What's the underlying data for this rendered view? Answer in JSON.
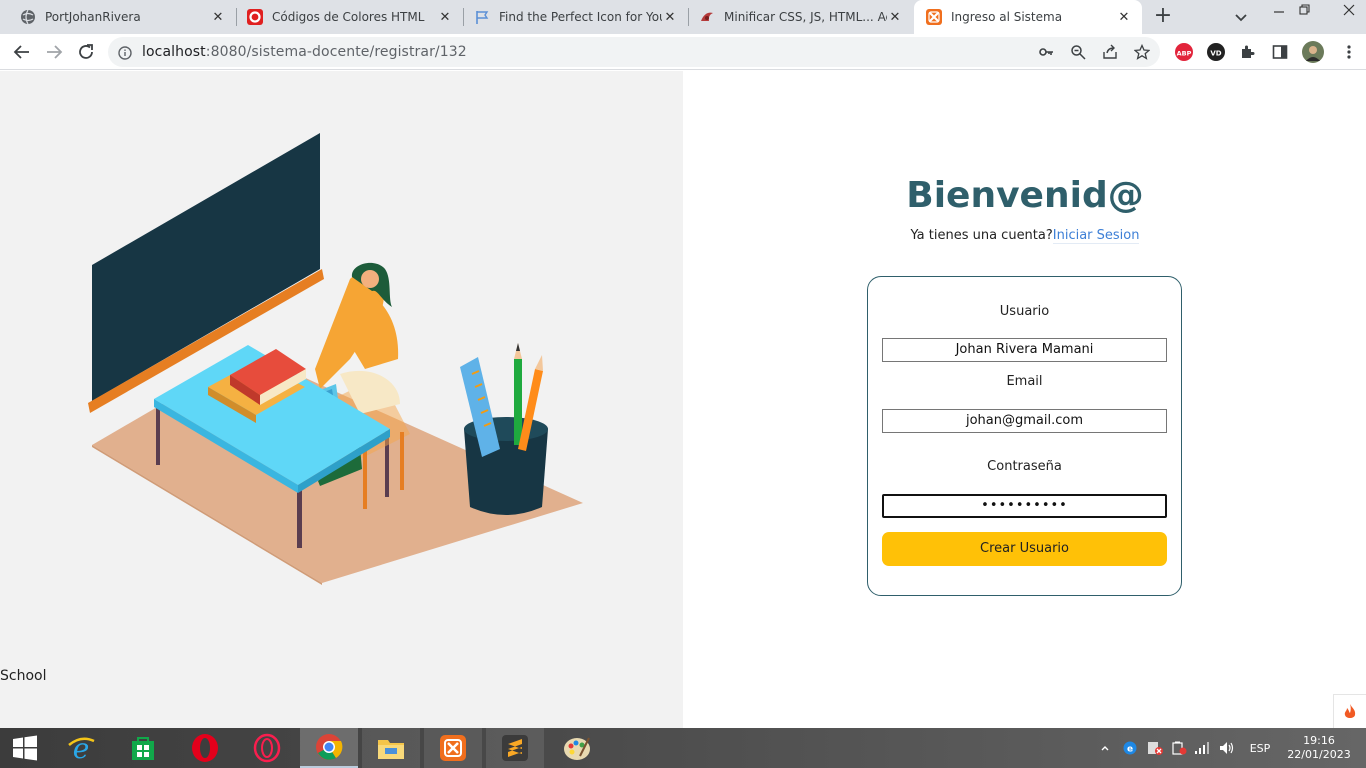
{
  "browser": {
    "tabs": [
      {
        "title": "PortJohanRivera",
        "favicon": "globe-icon"
      },
      {
        "title": "Códigos de Colores HTML",
        "favicon": "opera-red-icon"
      },
      {
        "title": "Find the Perfect Icon for Your P",
        "favicon": "flag-icon"
      },
      {
        "title": "Minificar CSS, JS, HTML... Acele",
        "favicon": "bird-icon"
      },
      {
        "title": "Ingreso al Sistema",
        "favicon": "xampp-icon",
        "active": true
      }
    ],
    "url_host": "localhost",
    "url_rest": ":8080/sistema-docente/registrar/132"
  },
  "page": {
    "illustration_caption": "School",
    "heading": "Bienvenid@",
    "account_prompt": "Ya tienes una cuenta?",
    "login_link": "Iniciar Sesion",
    "form": {
      "username_label": "Usuario",
      "username_value": "Johan Rivera Mamani",
      "email_label": "Email",
      "email_value": "johan@gmail.com",
      "password_label": "Contraseña",
      "password_value": "••••••••••",
      "submit_label": "Crear Usuario"
    }
  },
  "taskbar": {
    "apps": [
      "windows-start-icon",
      "internet-explorer-icon",
      "store-icon",
      "opera-icon",
      "opera-gx-icon",
      "chrome-icon",
      "file-explorer-icon",
      "xampp-icon",
      "sublime-text-icon",
      "paint-icon"
    ],
    "language": "ESP",
    "time": "19:16",
    "date": "22/01/2023"
  },
  "colors": {
    "heading": "#2f5f6b",
    "link": "#3d7fd6",
    "submit": "#ffc107",
    "left_panel": "#f2f2f2"
  }
}
